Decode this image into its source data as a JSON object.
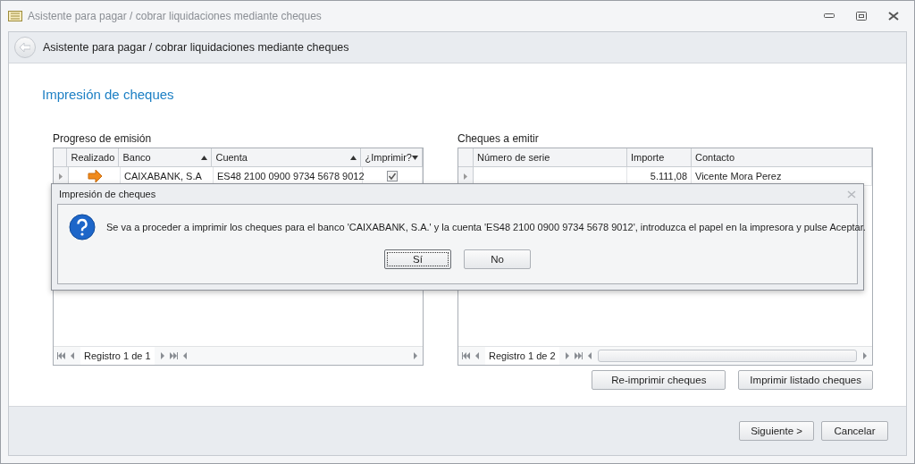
{
  "window": {
    "title": "Asistente para pagar / cobrar liquidaciones mediante cheques"
  },
  "header": {
    "title": "Asistente para pagar / cobrar liquidaciones mediante cheques"
  },
  "page_title": "Impresión de cheques",
  "progress": {
    "label": "Progreso de emisión",
    "columns": [
      {
        "label": "Realizado",
        "sorted": false,
        "filter": false
      },
      {
        "label": "Banco",
        "sorted": true,
        "filter": false
      },
      {
        "label": "Cuenta",
        "sorted": true,
        "filter": false
      },
      {
        "label": "¿Imprimir?",
        "sorted": false,
        "filter": true
      }
    ],
    "rows": [
      {
        "kind": "progress",
        "banco": "CAIXABANK, S.A",
        "cuenta": "ES48 2100 0900 9734 5678 9012",
        "imprimir": true
      }
    ],
    "navigator": "Registro 1 de 1"
  },
  "cheques": {
    "label": "Cheques a emitir",
    "columns": [
      {
        "label": "Número de serie"
      },
      {
        "label": "Importe"
      },
      {
        "label": "Contacto"
      }
    ],
    "rows": [
      {
        "importe": "5.111,08",
        "contacto": "Vicente Mora Perez"
      }
    ],
    "navigator": "Registro 1 de 2"
  },
  "actions": [
    "Re-imprimir cheques",
    "Imprimir listado cheques"
  ],
  "dialog": {
    "title": "Impresión de cheques",
    "message": "Se va a proceder a imprimir los cheques para el banco 'CAIXABANK, S.A.' y la cuenta 'ES48 2100 0900 9734 5678 9012', introduzca el papel en la impresora y pulse Aceptar.",
    "buttons": [
      {
        "label": "Sí",
        "selected": true
      },
      {
        "label": "No",
        "selected": false
      }
    ]
  },
  "footer": {
    "buttons": [
      "Siguiente >",
      "Cancelar"
    ]
  }
}
